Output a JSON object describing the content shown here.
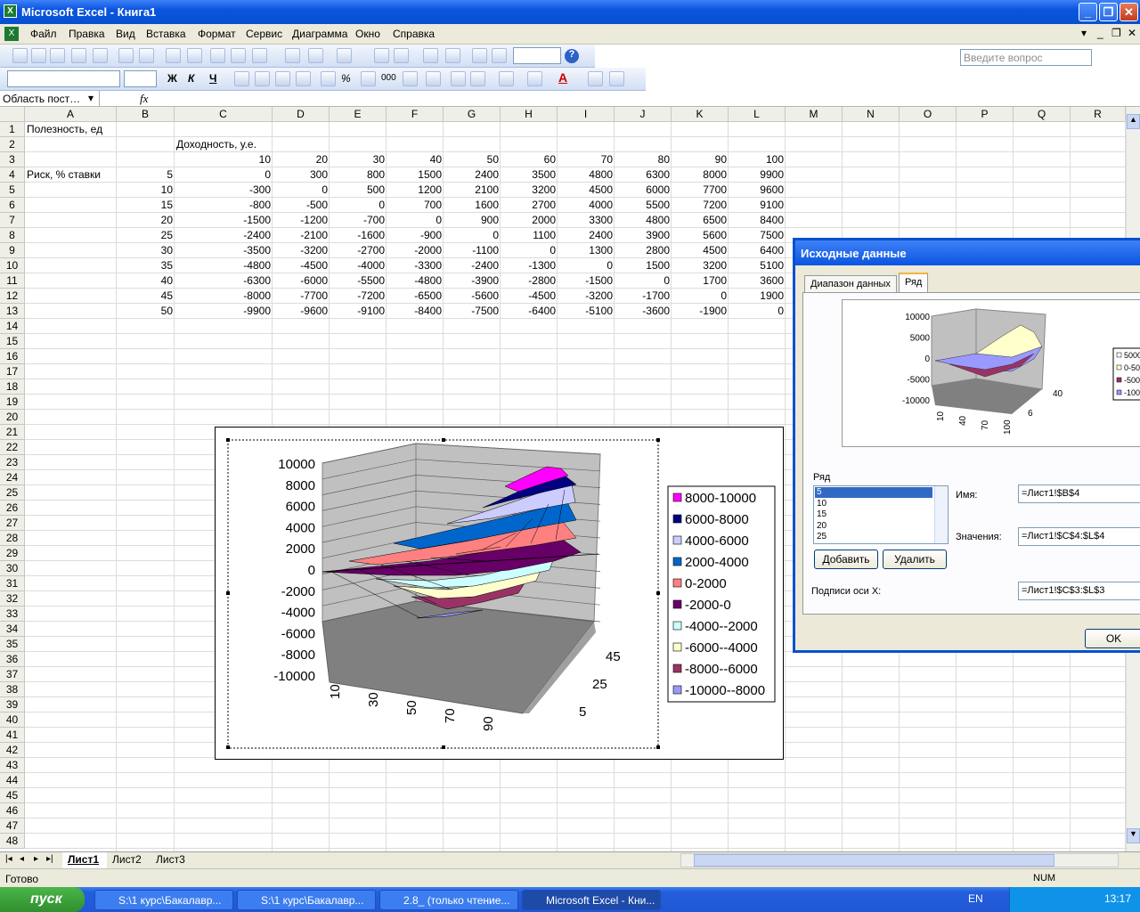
{
  "window": {
    "title": "Microsoft Excel - Книга1"
  },
  "menu": [
    "Файл",
    "Правка",
    "Вид",
    "Вставка",
    "Формат",
    "Сервис",
    "Диаграмма",
    "Окно",
    "Справка"
  ],
  "help_placeholder": "Введите вопрос",
  "namebox": "Область пост…",
  "fx": "fx",
  "columns": [
    "A",
    "B",
    "C",
    "D",
    "E",
    "F",
    "G",
    "H",
    "I",
    "J",
    "K",
    "L",
    "M",
    "N",
    "O",
    "P",
    "Q",
    "R"
  ],
  "cells": {
    "a1": "Полезность, ед",
    "c2": "Доходность, у.е.",
    "a4": "Риск, % ставки",
    "header_row": [
      "10",
      "20",
      "30",
      "40",
      "50",
      "60",
      "70",
      "80",
      "90",
      "100"
    ],
    "risk": [
      "5",
      "10",
      "15",
      "20",
      "25",
      "30",
      "35",
      "40",
      "45",
      "50"
    ],
    "values": [
      [
        "0",
        "300",
        "800",
        "1500",
        "2400",
        "3500",
        "4800",
        "6300",
        "8000",
        "9900"
      ],
      [
        "-300",
        "0",
        "500",
        "1200",
        "2100",
        "3200",
        "4500",
        "6000",
        "7700",
        "9600"
      ],
      [
        "-800",
        "-500",
        "0",
        "700",
        "1600",
        "2700",
        "4000",
        "5500",
        "7200",
        "9100"
      ],
      [
        "-1500",
        "-1200",
        "-700",
        "0",
        "900",
        "2000",
        "3300",
        "4800",
        "6500",
        "8400"
      ],
      [
        "-2400",
        "-2100",
        "-1600",
        "-900",
        "0",
        "1100",
        "2400",
        "3900",
        "5600",
        "7500"
      ],
      [
        "-3500",
        "-3200",
        "-2700",
        "-2000",
        "-1100",
        "0",
        "1300",
        "2800",
        "4500",
        "6400"
      ],
      [
        "-4800",
        "-4500",
        "-4000",
        "-3300",
        "-2400",
        "-1300",
        "0",
        "1500",
        "3200",
        "5100"
      ],
      [
        "-6300",
        "-6000",
        "-5500",
        "-4800",
        "-3900",
        "-2800",
        "-1500",
        "0",
        "1700",
        "3600"
      ],
      [
        "-8000",
        "-7700",
        "-7200",
        "-6500",
        "-5600",
        "-4500",
        "-3200",
        "-1700",
        "0",
        "1900"
      ],
      [
        "-9900",
        "-9600",
        "-9100",
        "-8400",
        "-7500",
        "-6400",
        "-5100",
        "-3600",
        "-1900",
        "0"
      ]
    ]
  },
  "chart_data": {
    "type": "surface",
    "y_ticks": [
      "10000",
      "8000",
      "6000",
      "4000",
      "2000",
      "0",
      "-2000",
      "-4000",
      "-6000",
      "-8000",
      "-10000"
    ],
    "x_ticks": [
      "10",
      "30",
      "50",
      "70",
      "90"
    ],
    "depth_ticks": [
      "45",
      "25",
      "5"
    ],
    "legend": [
      {
        "label": "8000-10000",
        "color": "#ff00ff"
      },
      {
        "label": "6000-8000",
        "color": "#000080"
      },
      {
        "label": "4000-6000",
        "color": "#ccccff"
      },
      {
        "label": "2000-4000",
        "color": "#0066cc"
      },
      {
        "label": "0-2000",
        "color": "#ff8080"
      },
      {
        "label": "-2000-0",
        "color": "#660066"
      },
      {
        "label": "-4000--2000",
        "color": "#ccffff"
      },
      {
        "label": "-6000--4000",
        "color": "#ffffcc"
      },
      {
        "label": "-8000--6000",
        "color": "#993366"
      },
      {
        "label": "-10000--8000",
        "color": "#9999ff"
      }
    ]
  },
  "dialog": {
    "title": "Исходные данные",
    "tab1": "Диапазон данных",
    "tab2": "Ряд",
    "preview_y": [
      "10000",
      "5000",
      "0",
      "-5000",
      "-10000"
    ],
    "preview_x": [
      "10",
      "40",
      "70",
      "100"
    ],
    "preview_depth": [
      "40",
      "6"
    ],
    "preview_legend": [
      "5000",
      "0-50",
      "-500",
      "-100"
    ],
    "series_label": "Ряд",
    "series": [
      "5",
      "10",
      "15",
      "20",
      "25"
    ],
    "name_label": "Имя:",
    "name_value": "=Лист1!$B$4",
    "values_label": "Значения:",
    "values_value": "=Лист1!$C$4:$L$4",
    "add": "Добавить",
    "remove": "Удалить",
    "xaxis_label": "Подписи оси X:",
    "xaxis_value": "=Лист1!$C$3:$L$3",
    "ok": "OK"
  },
  "sheets": [
    "Лист1",
    "Лист2",
    "Лист3"
  ],
  "status": {
    "left": "Готово",
    "num": "NUM"
  },
  "taskbar": {
    "start": "пуск",
    "tasks": [
      "S:\\1 курс\\Бакалавр...",
      "S:\\1 курс\\Бакалавр...",
      "2.8_ (только чтение...",
      "Microsoft Excel - Кни..."
    ],
    "lang": "EN",
    "time": "13:17"
  }
}
